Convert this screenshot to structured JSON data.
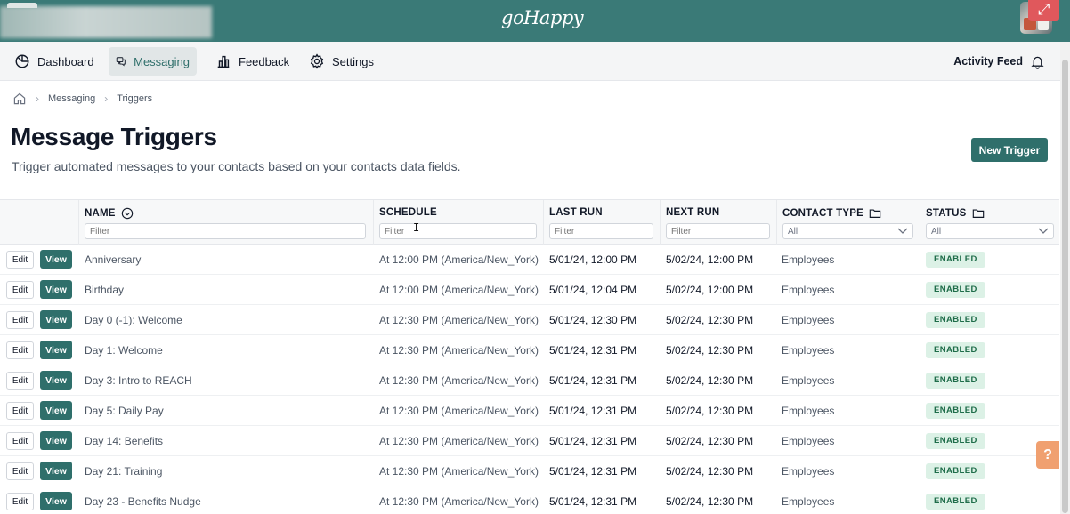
{
  "header": {
    "logo": "goHappy"
  },
  "nav": {
    "items": [
      {
        "label": "Dashboard",
        "icon": "dashboard-icon"
      },
      {
        "label": "Messaging",
        "icon": "messaging-icon",
        "active": true
      },
      {
        "label": "Feedback",
        "icon": "bar-chart-icon"
      },
      {
        "label": "Settings",
        "icon": "gear-icon"
      }
    ],
    "activity_feed": "Activity Feed"
  },
  "breadcrumb": [
    "Messaging",
    "Triggers"
  ],
  "page": {
    "title": "Message Triggers",
    "subtitle": "Trigger automated messages to your contacts based on your contacts data fields.",
    "new_button": "New Trigger"
  },
  "table": {
    "columns": {
      "name": "NAME",
      "schedule": "SCHEDULE",
      "last_run": "LAST RUN",
      "next_run": "NEXT RUN",
      "contact_type": "CONTACT TYPE",
      "status": "STATUS"
    },
    "filter_placeholder": "Filter",
    "select_all": "All",
    "edit_label": "Edit",
    "view_label": "View",
    "rows": [
      {
        "name": "Anniversary",
        "schedule": "At 12:00 PM (America/New_York)",
        "last_run": "5/01/24, 12:00 PM",
        "next_run": "5/02/24, 12:00 PM",
        "contact_type": "Employees",
        "status": "ENABLED"
      },
      {
        "name": "Birthday",
        "schedule": "At 12:00 PM (America/New_York)",
        "last_run": "5/01/24, 12:04 PM",
        "next_run": "5/02/24, 12:00 PM",
        "contact_type": "Employees",
        "status": "ENABLED"
      },
      {
        "name": "Day 0 (-1): Welcome",
        "schedule": "At 12:30 PM (America/New_York)",
        "last_run": "5/01/24, 12:30 PM",
        "next_run": "5/02/24, 12:30 PM",
        "contact_type": "Employees",
        "status": "ENABLED"
      },
      {
        "name": "Day 1: Welcome",
        "schedule": "At 12:30 PM (America/New_York)",
        "last_run": "5/01/24, 12:31 PM",
        "next_run": "5/02/24, 12:30 PM",
        "contact_type": "Employees",
        "status": "ENABLED"
      },
      {
        "name": "Day 3: Intro to REACH",
        "schedule": "At 12:30 PM (America/New_York)",
        "last_run": "5/01/24, 12:31 PM",
        "next_run": "5/02/24, 12:30 PM",
        "contact_type": "Employees",
        "status": "ENABLED"
      },
      {
        "name": "Day 5: Daily Pay",
        "schedule": "At 12:30 PM (America/New_York)",
        "last_run": "5/01/24, 12:31 PM",
        "next_run": "5/02/24, 12:30 PM",
        "contact_type": "Employees",
        "status": "ENABLED"
      },
      {
        "name": "Day 14: Benefits",
        "schedule": "At 12:30 PM (America/New_York)",
        "last_run": "5/01/24, 12:31 PM",
        "next_run": "5/02/24, 12:30 PM",
        "contact_type": "Employees",
        "status": "ENABLED"
      },
      {
        "name": "Day 21: Training",
        "schedule": "At 12:30 PM (America/New_York)",
        "last_run": "5/01/24, 12:31 PM",
        "next_run": "5/02/24, 12:30 PM",
        "contact_type": "Employees",
        "status": "ENABLED"
      },
      {
        "name": "Day 23 - Benefits Nudge",
        "schedule": "At 12:30 PM (America/New_York)",
        "last_run": "5/01/24, 12:31 PM",
        "next_run": "5/02/24, 12:30 PM",
        "contact_type": "Employees",
        "status": "ENABLED"
      }
    ]
  },
  "help": "?",
  "colors": {
    "brand": "#3a7a77",
    "primary_button": "#2f6f6b",
    "enabled_badge_bg": "#dcf1e6",
    "enabled_badge_text": "#1f6d4a"
  }
}
